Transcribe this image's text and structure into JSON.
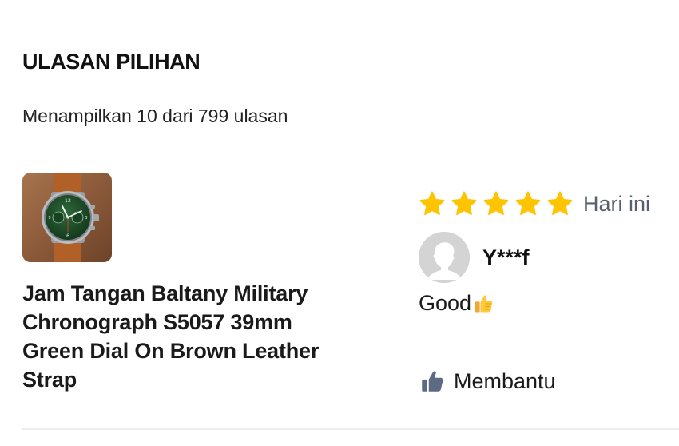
{
  "section": {
    "title": "ULASAN PILIHAN",
    "summary": "Menampilkan 10 dari 799 ulasan"
  },
  "review": {
    "product_name": "Jam Tangan Baltany Military Chronograph S5057 39mm Green Dial On Brown Leather Strap",
    "rating": 5,
    "rating_max": 5,
    "date": "Hari ini",
    "reviewer_name": "Y***f",
    "text": "Good",
    "text_emoji": "thumbs-up-emoji",
    "helpful_label": "Membantu",
    "helpful_icon": "thumbs-up-icon"
  },
  "colors": {
    "star": "#ffc400",
    "muted_text": "#58606e",
    "helpful_icon": "#5c6a84"
  }
}
